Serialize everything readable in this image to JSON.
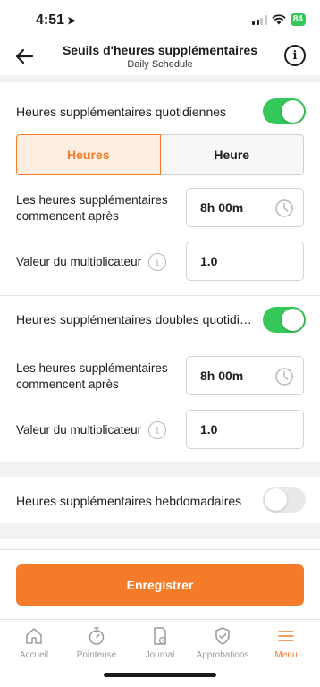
{
  "status": {
    "time": "4:51",
    "battery": "84"
  },
  "header": {
    "title": "Seuils d'heures supplémentaires",
    "subtitle": "Daily Schedule"
  },
  "daily": {
    "label": "Heures supplémentaires quotidiennes",
    "enabled": true,
    "segment": {
      "active": "Heures",
      "inactive": "Heure"
    },
    "start_label": "Les heures supplémentaires commencent après",
    "start_value": "8h 00m",
    "multiplier_label": "Valeur du multiplicateur",
    "multiplier_value": "1.0"
  },
  "double_daily": {
    "label": "Heures supplémentaires doubles quotidiennes",
    "enabled": true,
    "start_label": "Les heures supplémentaires commencent après",
    "start_value": "8h 00m",
    "multiplier_label": "Valeur du multiplicateur",
    "multiplier_value": "1.0"
  },
  "weekly": {
    "label": "Heures supplémentaires hebdomadaires",
    "enabled": false
  },
  "save_label": "Enregistrer",
  "tabs": [
    {
      "label": "Accueil",
      "icon": "home-icon"
    },
    {
      "label": "Pointeuse",
      "icon": "stopwatch-icon"
    },
    {
      "label": "Journal",
      "icon": "journal-icon"
    },
    {
      "label": "Approbations",
      "icon": "shield-check-icon"
    },
    {
      "label": "Menu",
      "icon": "menu-icon",
      "active": true
    }
  ],
  "colors": {
    "accent": "#f47b2a",
    "toggle_on": "#34c759"
  }
}
